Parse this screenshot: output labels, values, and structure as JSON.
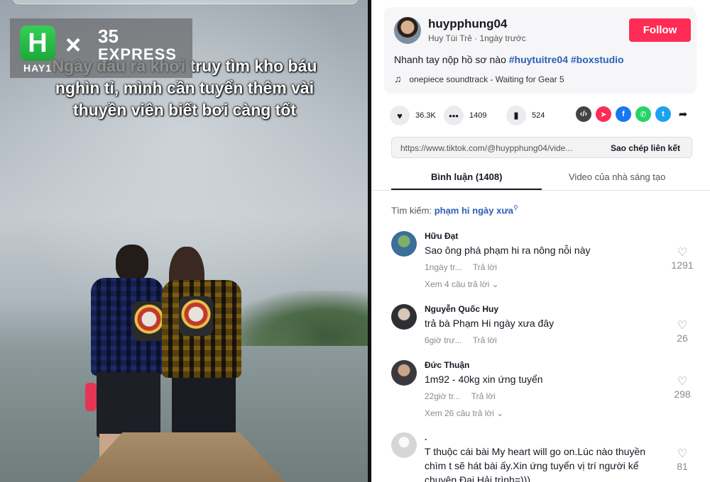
{
  "video": {
    "caption": "Ngày đầu ra khơi truy tìm kho báu nghìn tỉ, mình cần tuyển thêm vài thuyền viên biết bơi càng tốt"
  },
  "brand": {
    "hay1_letter": "H",
    "hay1_text": "HAY1",
    "times_symbol": "×",
    "partner_number": "35",
    "partner_name": "EXPRESS"
  },
  "post": {
    "username": "huypphung04",
    "nickname_line": "Huy Túi Trẻ · 1ngày trước",
    "follow_label": "Follow",
    "description_text": "Nhanh tay nộp hồ sơ nào",
    "hashtags": [
      "#huytuitre04",
      "#boxstudio"
    ],
    "music": "onepiece soundtrack - Waiting for Gear 5",
    "music_icon": "music-note-icon"
  },
  "actions": {
    "likes": "36.3K",
    "comments": "1409",
    "saves": "524",
    "share_targets": [
      "embed",
      "send",
      "facebook",
      "whatsapp",
      "twitter",
      "more"
    ]
  },
  "link": {
    "url": "https://www.tiktok.com/@huypphung04/vide...",
    "copy_label": "Sao chép liên kết"
  },
  "tabs": {
    "comments": "Bình luận (1408)",
    "creator_videos": "Video của nhà sáng tạo"
  },
  "search_hint": {
    "prefix": "Tìm kiếm:",
    "query": "phạm hi ngày xưa"
  },
  "comments": [
    {
      "name": "Hữu Đạt",
      "text": "Sao ông phá phạm hi ra nông nỗi này",
      "time": "1ngày tr...",
      "reply_label": "Trả lời",
      "likes": "1291",
      "more_replies": "Xem 4 câu trả lời"
    },
    {
      "name": "Nguyễn Quốc Huy",
      "text": "trả bà Phạm Hi ngày xưa đây",
      "time": "6giờ trư...",
      "reply_label": "Trả lời",
      "likes": "26"
    },
    {
      "name": "Đức Thuận",
      "text": "1m92 - 40kg xin ứng tuyển",
      "time": "22giờ tr...",
      "reply_label": "Trả lời",
      "likes": "298",
      "more_replies": "Xem 26 câu trả lời"
    },
    {
      "name": ".",
      "text": "T thuộc cái bài My heart will go on.Lúc nào thuyền chìm t sẽ hát bài ấy.Xin ứng tuyển vị trí người kể chuyện Đại Hải trình=)))",
      "likes": "81"
    }
  ],
  "colors": {
    "follow": "#fe2c55",
    "hashtag": "#2b5db9",
    "facebook": "#1877f2",
    "whatsapp": "#25d366",
    "twitter": "#1da1f2",
    "send": "#fe2c55",
    "embed": "#444444"
  }
}
